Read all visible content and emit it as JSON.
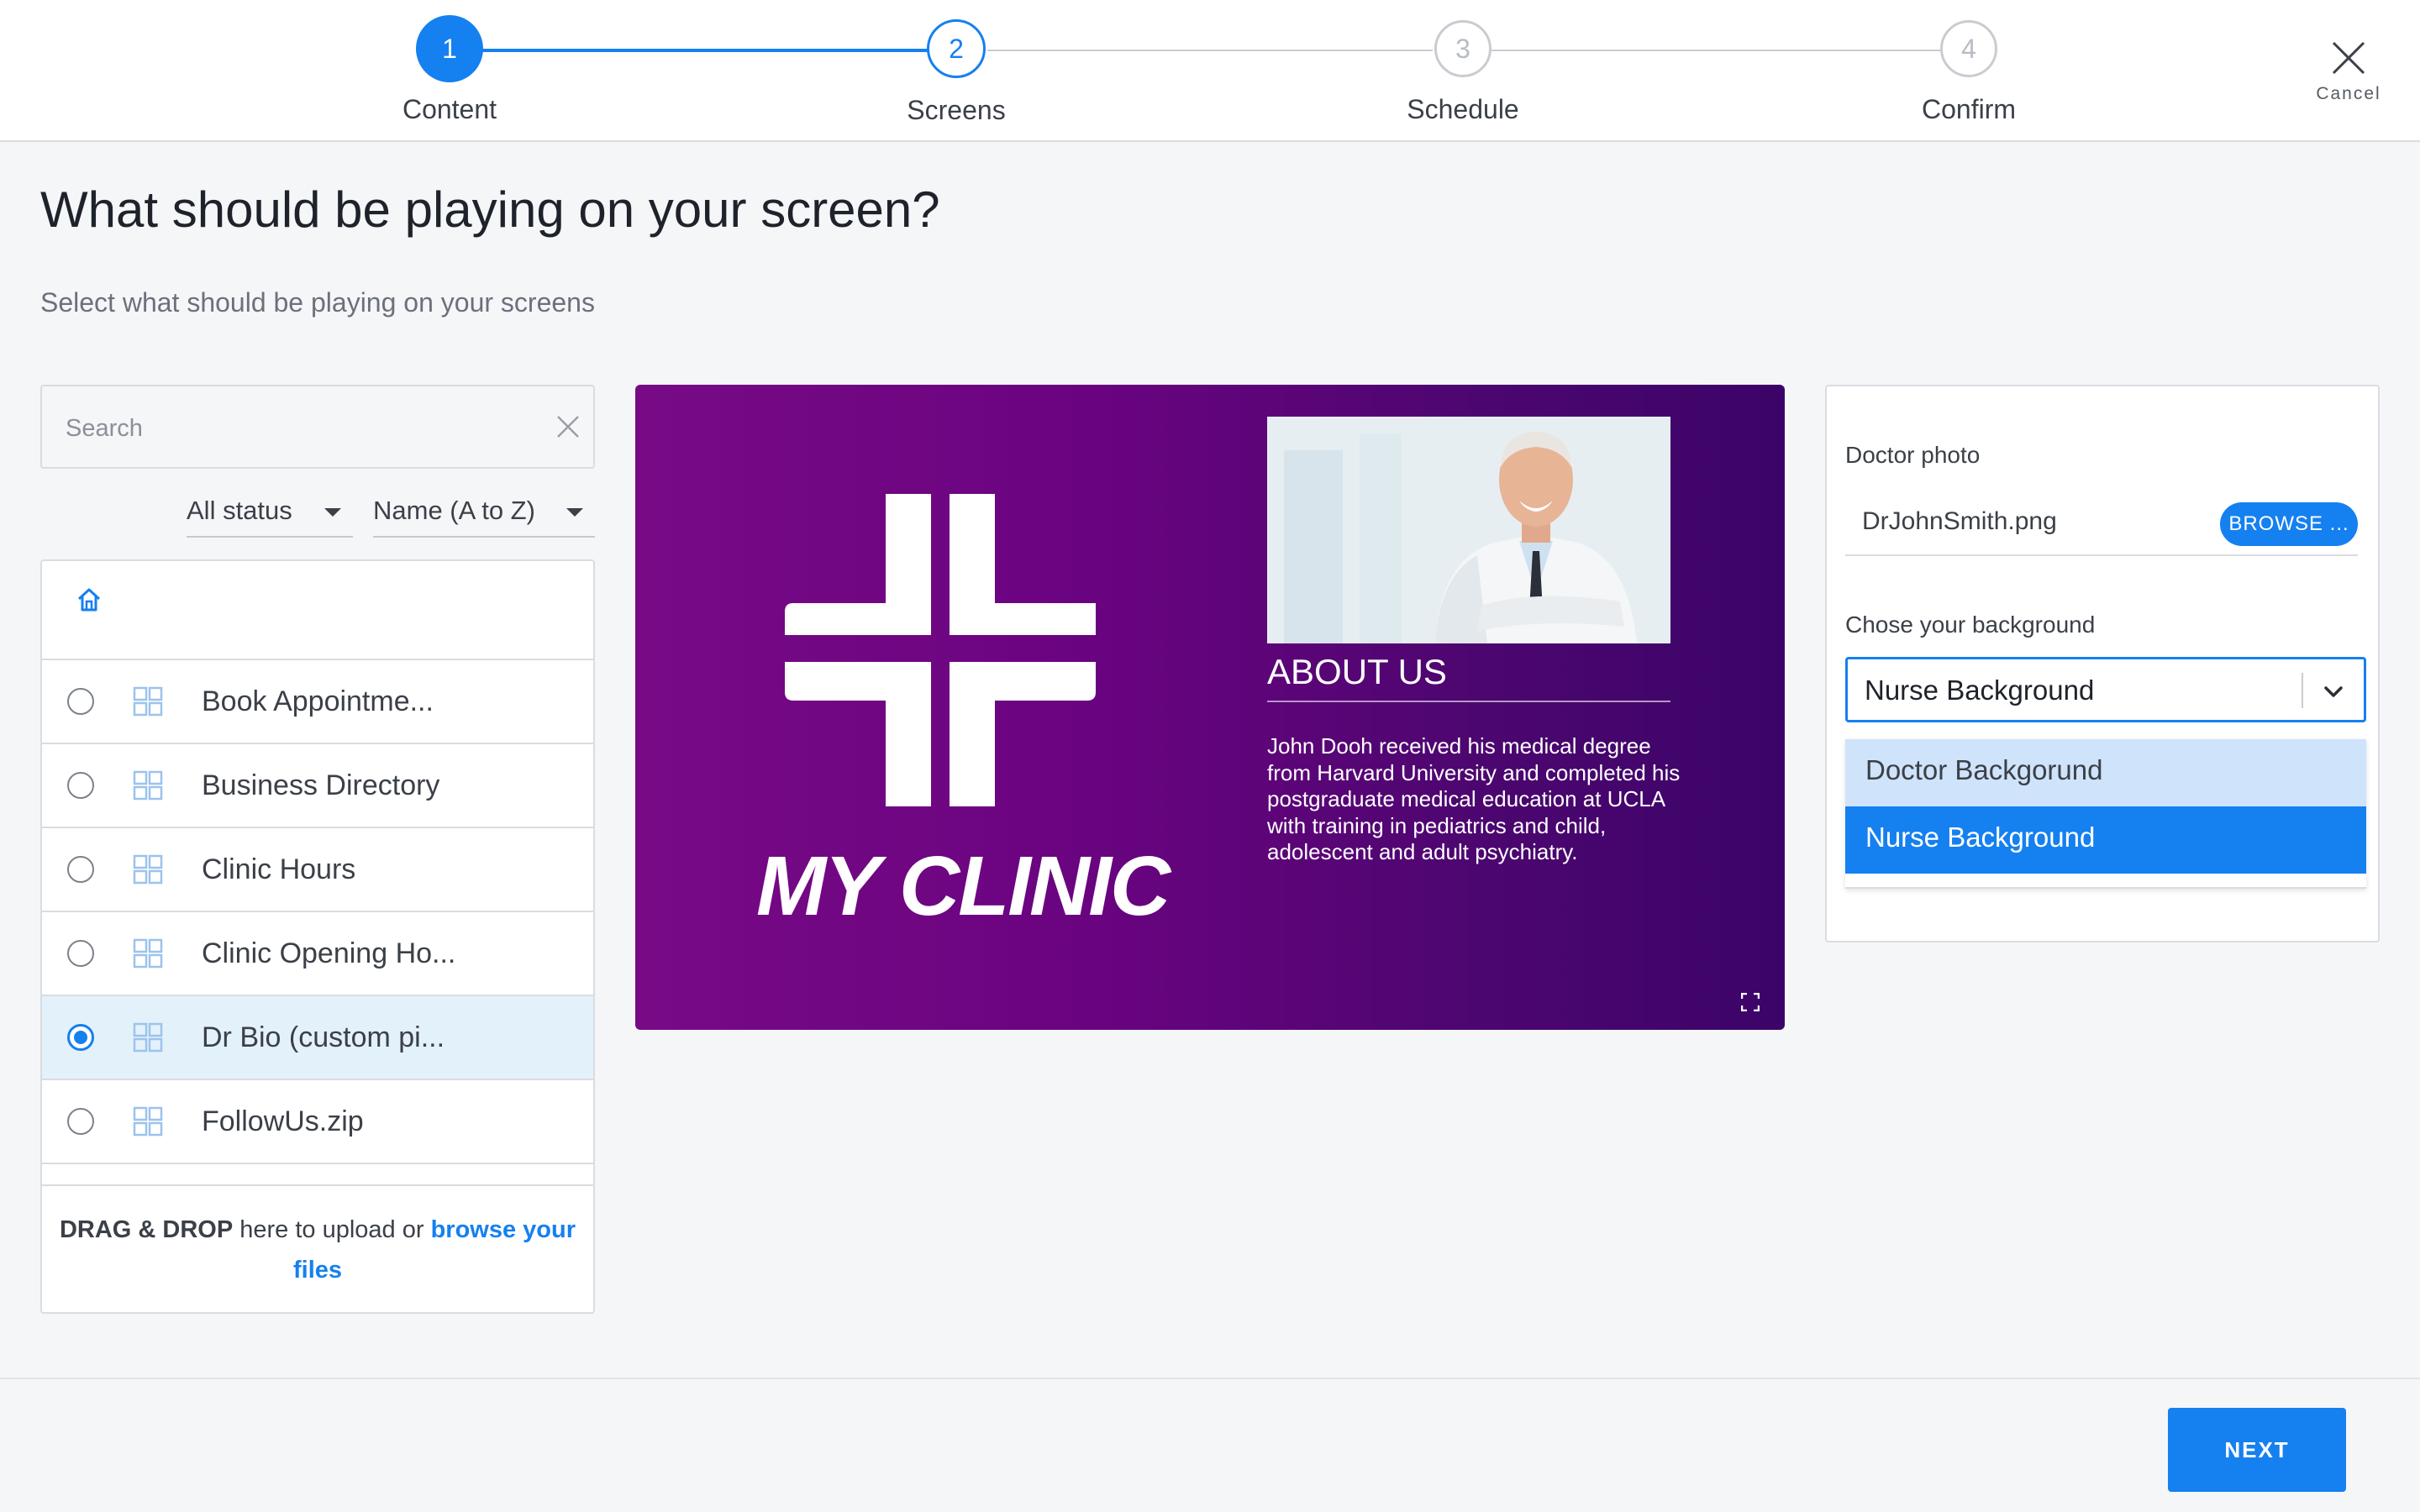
{
  "stepper": {
    "steps": [
      {
        "number": "1",
        "label": "Content",
        "state": "done"
      },
      {
        "number": "2",
        "label": "Screens",
        "state": "current"
      },
      {
        "number": "3",
        "label": "Schedule",
        "state": "pending"
      },
      {
        "number": "4",
        "label": "Confirm",
        "state": "pending"
      }
    ],
    "cancel_label": "Cancel"
  },
  "page": {
    "title": "What should be playing on your screen?",
    "subtitle": "Select what should be playing on your screens"
  },
  "library": {
    "search_placeholder": "Search",
    "status_filter": "All status",
    "sort_filter": "Name (A to Z)",
    "items": [
      {
        "label": "Book Appointme...",
        "selected": false
      },
      {
        "label": "Business Directory",
        "selected": false
      },
      {
        "label": "Clinic Hours",
        "selected": false
      },
      {
        "label": "Clinic Opening Ho...",
        "selected": false
      },
      {
        "label": "Dr Bio (custom pi...",
        "selected": true
      },
      {
        "label": "FollowUs.zip",
        "selected": false
      }
    ],
    "upload": {
      "bold": "DRAG & DROP",
      "text": " here to upload or ",
      "link": "browse your files"
    }
  },
  "preview": {
    "clinic_name": "MY CLINIC",
    "about_title": "ABOUT US",
    "about_text": "John Dooh received his medical degree from Harvard University and completed his postgraduate medical education at UCLA with training in pediatrics and child, adolescent and adult psychiatry."
  },
  "settings": {
    "photo_label": "Doctor photo",
    "photo_file": "DrJohnSmith.png",
    "browse_label": "BROWSE ...",
    "background_label": "Chose your background",
    "background_value": "Nurse Background",
    "background_options": [
      "Doctor Backgorund",
      "Nurse Background"
    ]
  },
  "footer": {
    "next_label": "NEXT"
  },
  "colors": {
    "accent": "#1580f0",
    "preview_gradient_start": "#780a86",
    "preview_gradient_end": "#3c0468"
  }
}
